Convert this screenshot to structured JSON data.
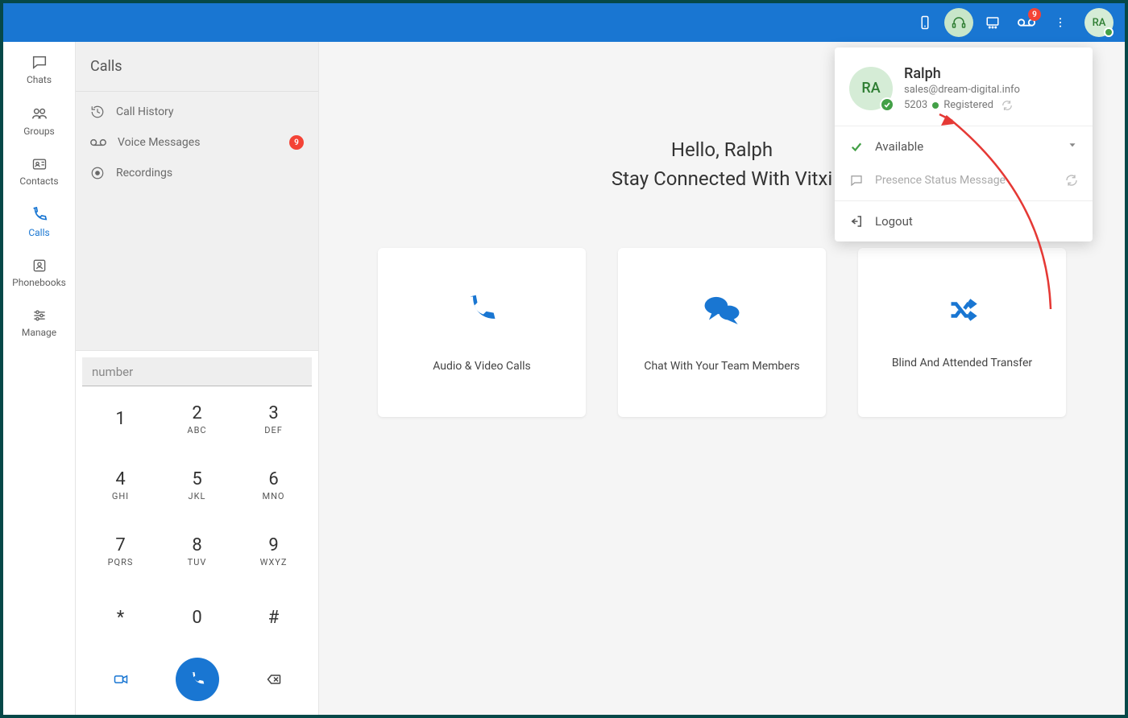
{
  "topbar": {
    "voicemail_badge": "9",
    "avatar_initials": "RA"
  },
  "rail": {
    "items": [
      {
        "label": "Chats"
      },
      {
        "label": "Groups"
      },
      {
        "label": "Contacts"
      },
      {
        "label": "Calls"
      },
      {
        "label": "Phonebooks"
      },
      {
        "label": "Manage"
      }
    ]
  },
  "panel": {
    "title": "Calls",
    "items": [
      {
        "label": "Call History"
      },
      {
        "label": "Voice Messages",
        "badge": "9"
      },
      {
        "label": "Recordings"
      }
    ]
  },
  "dialer": {
    "placeholder": "number",
    "keys": [
      {
        "digit": "1",
        "letters": ""
      },
      {
        "digit": "2",
        "letters": "ABC"
      },
      {
        "digit": "3",
        "letters": "DEF"
      },
      {
        "digit": "4",
        "letters": "GHI"
      },
      {
        "digit": "5",
        "letters": "JKL"
      },
      {
        "digit": "6",
        "letters": "MNO"
      },
      {
        "digit": "7",
        "letters": "PQRS"
      },
      {
        "digit": "8",
        "letters": "TUV"
      },
      {
        "digit": "9",
        "letters": "WXYZ"
      },
      {
        "digit": "*",
        "letters": ""
      },
      {
        "digit": "0",
        "letters": ""
      },
      {
        "digit": "#",
        "letters": ""
      }
    ]
  },
  "main": {
    "greeting": "Hello, Ralph",
    "subtitle": "Stay Connected With Vitxi",
    "cards": [
      {
        "label": "Audio & Video Calls"
      },
      {
        "label": "Chat With Your Team Members"
      },
      {
        "label": "Blind And Attended Transfer"
      }
    ]
  },
  "popover": {
    "initials": "RA",
    "name": "Ralph",
    "email": "sales@dream-digital.info",
    "extension": "5203",
    "status_label": "Registered",
    "availability": "Available",
    "presence_placeholder": "Presence Status Message",
    "logout": "Logout"
  }
}
